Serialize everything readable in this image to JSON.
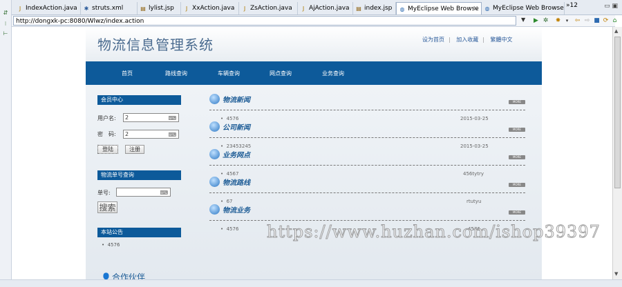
{
  "ide": {
    "tabs": [
      {
        "label": "IndexAction.java",
        "icon": "java-file-icon"
      },
      {
        "label": "struts.xml",
        "icon": "xml-file-icon"
      },
      {
        "label": "lylist.jsp",
        "icon": "jsp-file-icon"
      },
      {
        "label": "XxAction.java",
        "icon": "java-file-icon"
      },
      {
        "label": "ZsAction.java",
        "icon": "java-file-icon"
      },
      {
        "label": "AjAction.java",
        "icon": "java-file-icon"
      },
      {
        "label": "index.jsp",
        "icon": "jsp-file-icon"
      },
      {
        "label": "MyEclipse Web Browse",
        "icon": "globe-icon",
        "active": true
      },
      {
        "label": "MyEclipse Web Browse",
        "icon": "globe-icon"
      }
    ],
    "tab_overflow": "»12",
    "url": "http://dongxk-pc:8080/Wlwz/index.action"
  },
  "site": {
    "title": "物流信息管理系统",
    "top_links": [
      "设为首页",
      "加入收藏",
      "繁體中文"
    ],
    "nav": [
      "首页",
      "路线查询",
      "车辆查询",
      "网点查询",
      "业务查询"
    ],
    "member": {
      "heading": "会员中心",
      "username_label": "用户名:",
      "username_value": "2",
      "password_label": "密　码:",
      "password_value": "2",
      "login_button": "登陆",
      "register_button": "注册"
    },
    "tracking": {
      "heading": "物流单号查询",
      "number_label": "单号:",
      "search_button": "搜索"
    },
    "notice": {
      "heading": "本站公告",
      "items": [
        "4576"
      ]
    },
    "sections": [
      {
        "title": "物流新闻",
        "more": "MORE",
        "item": "4576",
        "right": "2015-03-25"
      },
      {
        "title": "公司新闻",
        "more": "MORE",
        "item": "23453245",
        "right": "2015-03-25"
      },
      {
        "title": "业务网点",
        "more": "MORE",
        "item": "4567",
        "right": "456tytry"
      },
      {
        "title": "物流路线",
        "more": "MORE",
        "item": "67",
        "right": "rtutyu"
      },
      {
        "title": "物流业务",
        "more": "MORE",
        "item": "4576",
        "right": "4576"
      }
    ],
    "partner_title": "合作伙伴"
  },
  "watermark": "https://www.huzhan.com/ishop39397"
}
